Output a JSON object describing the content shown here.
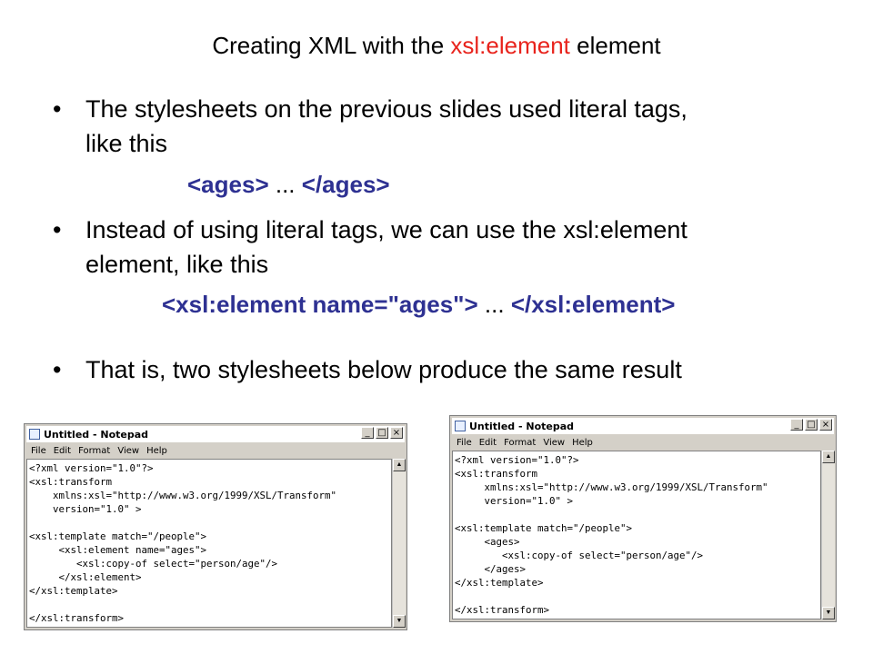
{
  "slide": {
    "title_prefix": "Creating XML with the ",
    "title_highlight": "xsl:element",
    "title_suffix": " element",
    "bullet_char": "•",
    "bullet1_line1": "The stylesheets on the previous slides used literal tags,",
    "bullet1_line2": "like this",
    "code1_open": "<ages>",
    "code1_mid": " ... ",
    "code1_close": "</ages>",
    "bullet2_line1": "Instead of using literal tags, we can use the xsl:element",
    "bullet2_line2": "element, like this",
    "code2_open": "<xsl:element name=\"ages\">",
    "code2_mid": " ... ",
    "code2_close": "</xsl:element>",
    "bullet3": "That is, two stylesheets below produce the same result",
    "highlight_color": "#e8231c",
    "code_color": "#2e3192"
  },
  "notepad_left": {
    "title": "Untitled - Notepad",
    "menu": [
      "File",
      "Edit",
      "Format",
      "View",
      "Help"
    ],
    "buttons": [
      "_",
      "□",
      "×"
    ],
    "code": "<?xml version=\"1.0\"?>\n<xsl:transform\n    xmlns:xsl=\"http://www.w3.org/1999/XSL/Transform\"\n    version=\"1.0\" >\n\n<xsl:template match=\"/people\">\n     <xsl:element name=\"ages\">\n        <xsl:copy-of select=\"person/age\"/>\n     </xsl:element>\n</xsl:template>\n\n</xsl:transform>"
  },
  "notepad_right": {
    "title": "Untitled - Notepad",
    "menu": [
      "File",
      "Edit",
      "Format",
      "View",
      "Help"
    ],
    "buttons": [
      "_",
      "□",
      "×"
    ],
    "code": "<?xml version=\"1.0\"?>\n<xsl:transform\n     xmlns:xsl=\"http://www.w3.org/1999/XSL/Transform\"\n     version=\"1.0\" >\n\n<xsl:template match=\"/people\">\n     <ages>\n        <xsl:copy-of select=\"person/age\"/>\n     </ages>\n</xsl:template>\n\n</xsl:transform>"
  }
}
